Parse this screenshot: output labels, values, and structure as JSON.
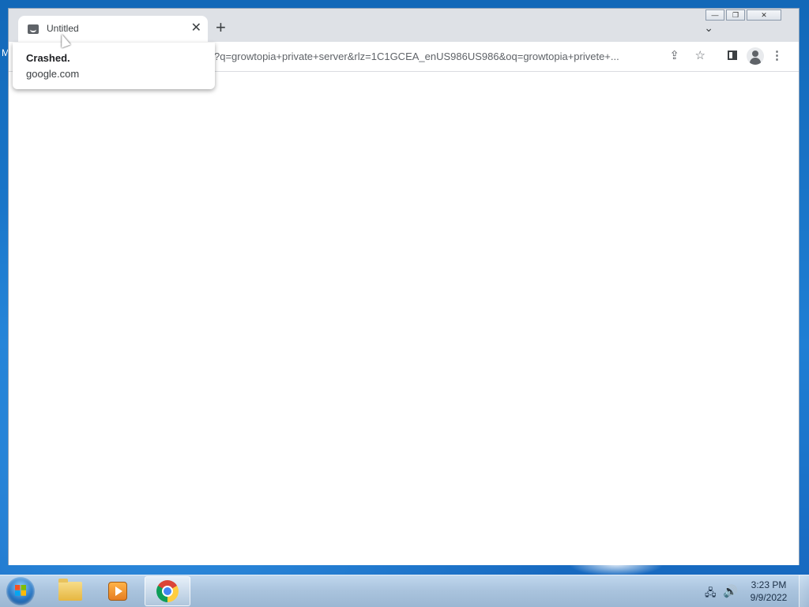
{
  "desktop": {
    "edge_letter": "M"
  },
  "browser": {
    "tab": {
      "title": "Untitled",
      "close_glyph": "✕"
    },
    "new_tab_glyph": "+",
    "tab_search_glyph": "⌄",
    "url": "?q=growtopia+private+server&rlz=1C1GCEA_enUS986US986&oq=growtopia+privete+...",
    "icons": {
      "share": "share-icon",
      "star": "star-icon",
      "side_panel": "side-panel-icon",
      "profile": "profile-icon",
      "menu": "menu-icon"
    },
    "hover_card": {
      "title": "Crashed.",
      "domain": "google.com"
    },
    "caption": {
      "minimize": "—",
      "restore": "❐",
      "close": "✕"
    }
  },
  "taskbar": {
    "apps": [
      {
        "name": "Windows Explorer",
        "icon": "folder-icon"
      },
      {
        "name": "Windows Media Player",
        "icon": "media-player-icon"
      },
      {
        "name": "Google Chrome",
        "icon": "chrome-icon",
        "active": true
      }
    ],
    "tray": {
      "network_glyph": "🖧",
      "volume_glyph": "🔊"
    },
    "clock": {
      "time": "3:23 PM",
      "date": "9/9/2022"
    }
  },
  "colors": {
    "chrome_frame": "#dee1e6",
    "desktop_blue": "#1f7fd4",
    "taskbar": "#a9c3dd"
  }
}
